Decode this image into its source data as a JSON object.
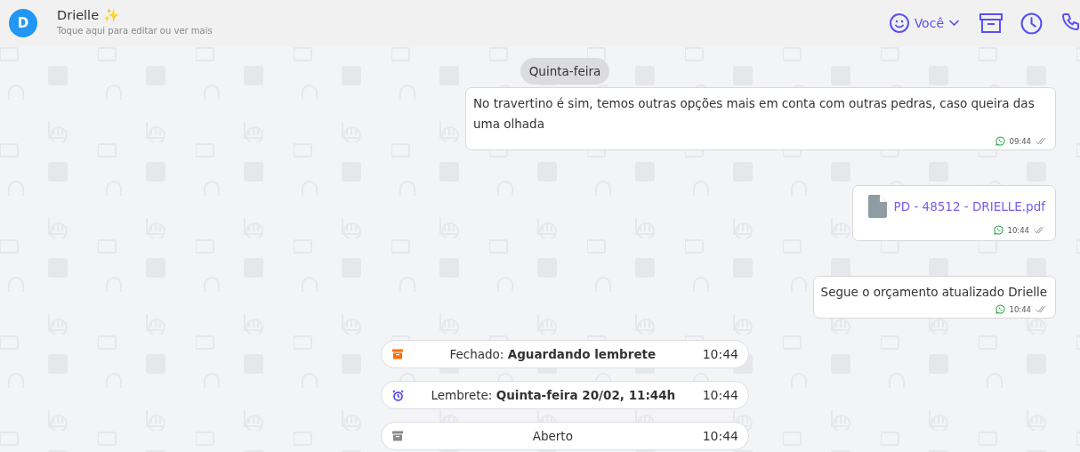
{
  "header": {
    "avatar_letter": "D",
    "name": "Drielle ✨",
    "subtitle": "Toque aqui para editar ou ver mais",
    "agent": "Você"
  },
  "messages": [
    {
      "kind": "day",
      "text": "Quinta-feira"
    },
    {
      "kind": "text",
      "text": "No travertino é sim, temos outras opções mais em conta com outras pedras, caso queira das uma olhada",
      "time": "09:44"
    },
    {
      "kind": "file",
      "file_name": "PD - 48512 - DRIELLE.pdf",
      "time": "10:44"
    },
    {
      "kind": "text",
      "text": "Segue o orçamento atualizado Drielle",
      "time": "10:44"
    },
    {
      "kind": "archive_event",
      "color": "#ff6d00",
      "text": "Fechado: **Aguardando lembrete**",
      "time": "10:44"
    },
    {
      "kind": "reminder_event",
      "color": "#5b4ff5",
      "text": "Lembrete: **Quinta-feira 20/02, 11:44h**",
      "time": "10:44"
    },
    {
      "kind": "archive_event",
      "color": "#8a8a8a",
      "text": "Aberto",
      "time": "10:44"
    }
  ]
}
